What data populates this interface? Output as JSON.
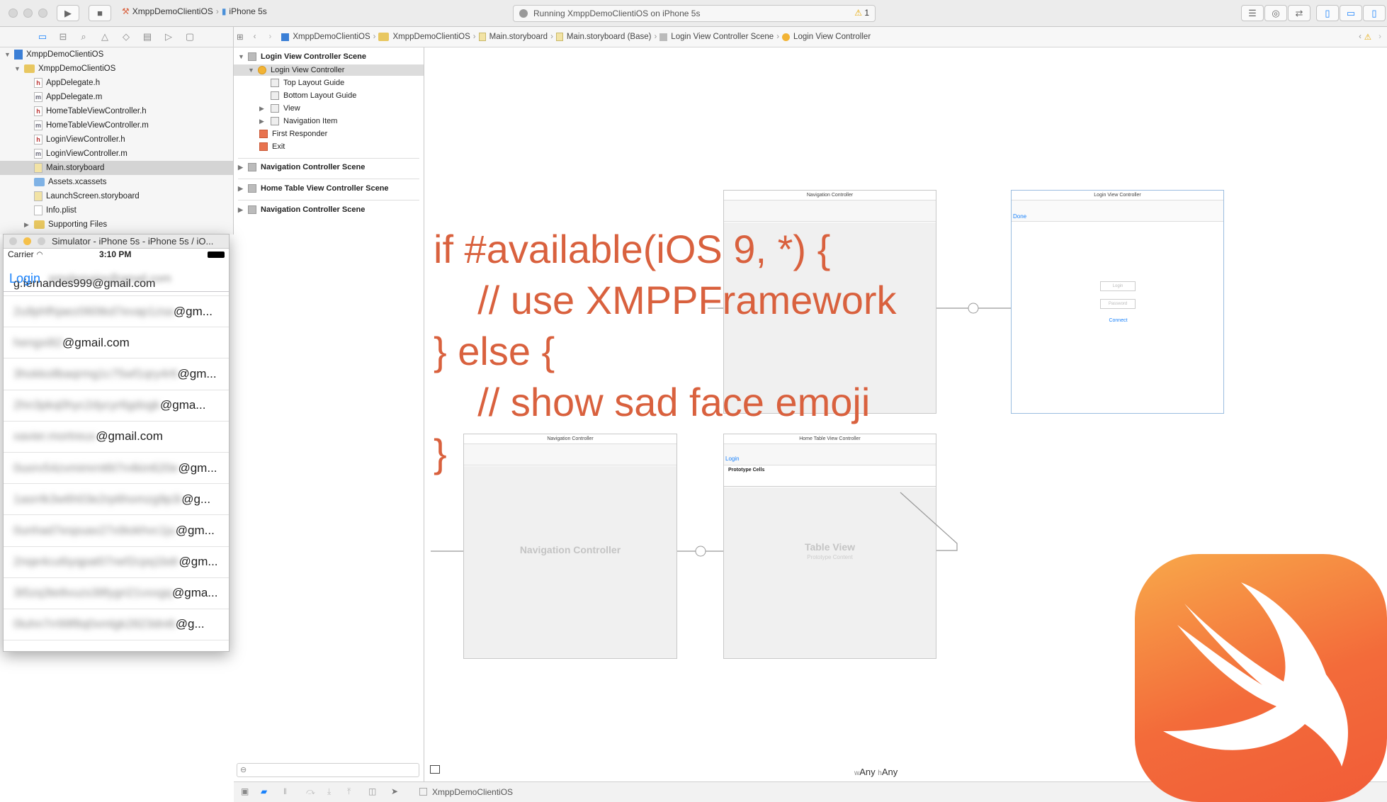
{
  "toolbar": {
    "scheme_target": "XmppDemoClientiOS",
    "device": "iPhone 5s",
    "activity": "Running XmppDemoClientiOS on iPhone 5s",
    "warning_count": "1"
  },
  "navigator": {
    "items": [
      {
        "label": "XmppDemoClientiOS",
        "type": "project"
      },
      {
        "label": "XmppDemoClientiOS",
        "type": "folder"
      },
      {
        "label": "AppDelegate.h",
        "type": "h"
      },
      {
        "label": "AppDelegate.m",
        "type": "m"
      },
      {
        "label": "HomeTableViewController.h",
        "type": "h"
      },
      {
        "label": "HomeTableViewController.m",
        "type": "m"
      },
      {
        "label": "LoginViewController.h",
        "type": "h"
      },
      {
        "label": "LoginViewController.m",
        "type": "m"
      },
      {
        "label": "Main.storyboard",
        "type": "storyboard"
      },
      {
        "label": "Assets.xcassets",
        "type": "folder"
      },
      {
        "label": "LaunchScreen.storyboard",
        "type": "storyboard"
      },
      {
        "label": "Info.plist",
        "type": "plist"
      },
      {
        "label": "Supporting Files",
        "type": "folder"
      }
    ]
  },
  "simulator": {
    "title": "Simulator - iPhone 5s - iPhone 5s / iO...",
    "carrier": "Carrier",
    "time": "3:10 PM",
    "nav_login": "Login",
    "nav_user_blurred": "pmglemaire@gmail.com",
    "emails": [
      {
        "blur": "",
        "visible": "g.fernandes999@gmail.com"
      },
      {
        "blur": "2u9phfhjaez060tkd7evap1zsa",
        "visible": "@gm..."
      },
      {
        "blur": "hengxi82",
        "visible": "@gmail.com"
      },
      {
        "blur": "3hokkollbaqrmg1c75wf1qry4r6",
        "visible": "@gm..."
      },
      {
        "blur": "2hn3pkq0hyc2dycyr6gdogk",
        "visible": "@gma..."
      },
      {
        "blur": "xavier.mortreux",
        "visible": "@gmail.com"
      },
      {
        "blur": "0uorv54zvmimrnt6t7n4kin620e",
        "visible": "@gm..."
      },
      {
        "blur": "1asrrlk3w6h03e2rp6homzg9p3i",
        "visible": "@g..."
      },
      {
        "blur": "0unhad7espuax27x9iokhvc1ju",
        "visible": "@gm..."
      },
      {
        "blur": "2nqe4cu6iyqpat07nef2cpq1bdr",
        "visible": "@gm..."
      },
      {
        "blur": "3t5zq3te8vuzs38fygri21vxxgq",
        "visible": "@gma..."
      },
      {
        "blur": "0luhn7rr99f8q0xmlgk2823dni6",
        "visible": "@g..."
      }
    ]
  },
  "breadcrumb": [
    "XmppDemoClientiOS",
    "XmppDemoClientiOS",
    "Main.storyboard",
    "Main.storyboard (Base)",
    "Login View Controller Scene",
    "Login View Controller"
  ],
  "outline": {
    "scene1": "Login View Controller Scene",
    "login_vc": "Login View Controller",
    "top_guide": "Top Layout Guide",
    "bottom_guide": "Bottom Layout Guide",
    "view": "View",
    "nav_item": "Navigation Item",
    "first_responder": "First Responder",
    "exit": "Exit",
    "scene2": "Navigation Controller Scene",
    "scene3": "Home Table View Controller Scene",
    "scene4": "Navigation Controller Scene"
  },
  "canvas": {
    "nav1_header": "Navigation Controller",
    "login_header": "Login View Controller",
    "login_done": "Done",
    "login_field": "Login",
    "password_field": "Password",
    "connect": "Connect",
    "nav2_header": "Navigation Controller",
    "nav2_body": "Navigation Controller",
    "home_header": "Home Table View Controller",
    "home_login": "Login",
    "prototype_cells": "Prototype Cells",
    "table_view": "Table View",
    "prototype_content": "Prototype Content",
    "size_w": "Any",
    "size_h": "Any"
  },
  "overlay_code": {
    "lines": [
      "if #available(iOS 9, *) {",
      "    // use XMPPFramework",
      "} else {",
      "    // show sad face emoji",
      "}"
    ]
  },
  "bottom": {
    "target": "XmppDemoClientiOS"
  },
  "colors": {
    "code": "#d9613e",
    "ios_blue": "#1a82fb",
    "swift_start": "#f8a84a",
    "swift_end": "#f15c38"
  }
}
